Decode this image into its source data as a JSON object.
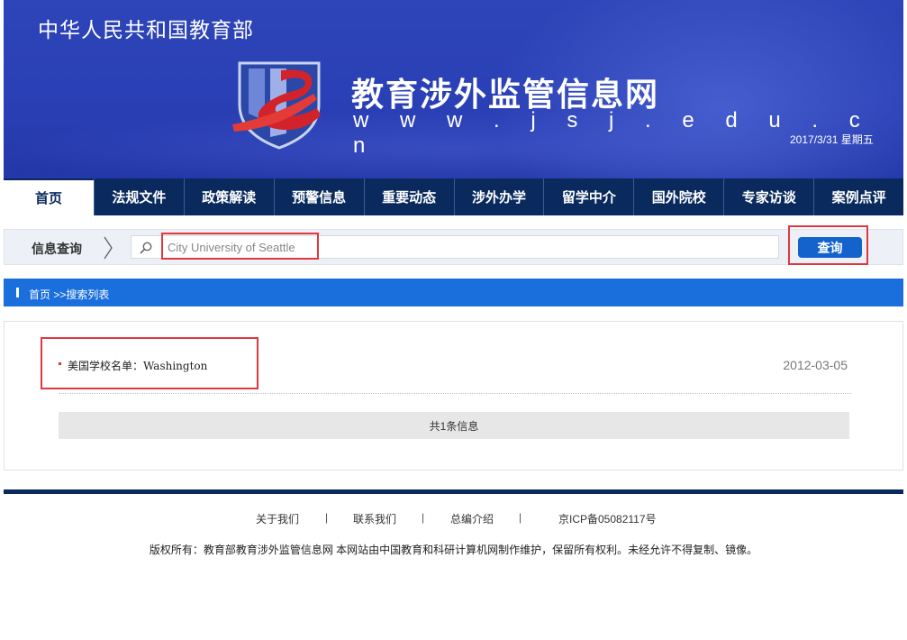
{
  "header": {
    "ministry": "中华人民共和国教育部",
    "site_title": "教育涉外监管信息网",
    "site_url": "w w w . j s j . e d u . c n",
    "date": "2017/3/31 星期五"
  },
  "nav": {
    "items": [
      {
        "label": "首页"
      },
      {
        "label": "法规文件"
      },
      {
        "label": "政策解读"
      },
      {
        "label": "预警信息"
      },
      {
        "label": "重要动态"
      },
      {
        "label": "涉外办学"
      },
      {
        "label": "留学中介"
      },
      {
        "label": "国外院校"
      },
      {
        "label": "专家访谈"
      },
      {
        "label": "案例点评"
      }
    ]
  },
  "search": {
    "label": "信息查询",
    "value": "City University of Seattle",
    "button": "查询"
  },
  "breadcrumb": {
    "home": "首页",
    "current": ">>搜索列表"
  },
  "results": {
    "items": [
      {
        "title": "美国学校名单：Washington",
        "date": "2012-03-05"
      }
    ],
    "total": "共1条信息"
  },
  "footer": {
    "links": [
      "关于我们",
      "联系我们",
      "总编介绍",
      "京ICP备05082117号"
    ],
    "separator": "|",
    "copyright": "版权所有：教育部教育涉外监管信息网 本网站由中国教育和科研计算机网制作维护，保留所有权利。未经允许不得复制、镜像。"
  },
  "colors": {
    "header_blue": "#2a3fb5",
    "nav_dark": "#0a2a5e",
    "breadcrumb_blue": "#1a6fdc",
    "button_blue": "#1463cc",
    "highlight_red": "#e0383e"
  }
}
